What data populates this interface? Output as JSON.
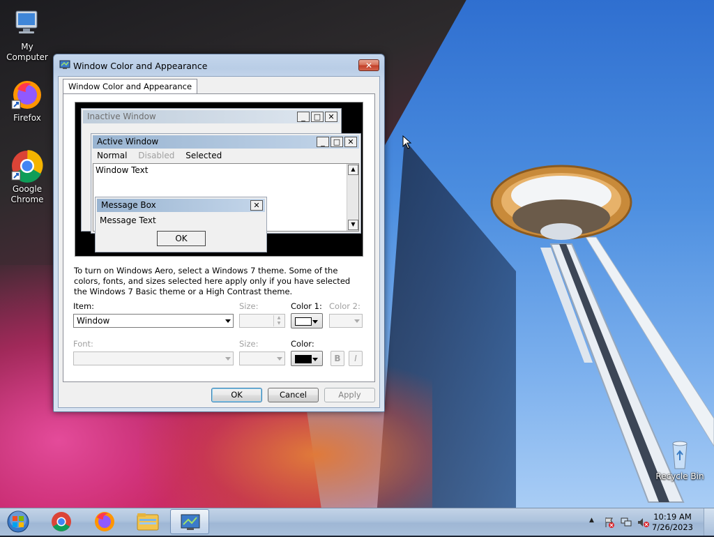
{
  "desktop": {
    "icons": [
      {
        "label": "My Computer"
      },
      {
        "label": "Firefox"
      },
      {
        "label": "Google Chrome"
      },
      {
        "label": "Recycle Bin"
      }
    ]
  },
  "dialog": {
    "title": "Window Color and Appearance",
    "close_label": "✕",
    "tab_label": "Window Color and Appearance",
    "preview": {
      "inactive_title": "Inactive Window",
      "active_title": "Active Window",
      "menu": [
        "Normal",
        "Disabled",
        "Selected"
      ],
      "window_text": "Window Text",
      "message_title": "Message Box",
      "message_text": "Message Text",
      "message_ok": "OK"
    },
    "description": "To turn on Windows Aero, select a Windows 7 theme.  Some of the colors, fonts, and sizes selected here apply only if you have selected the Windows 7 Basic theme or a High Contrast theme.",
    "item_label": "Item:",
    "item_value": "Window",
    "size_label": "Size:",
    "color1_label": "Color 1:",
    "color2_label": "Color 2:",
    "font_label": "Font:",
    "font_size_label": "Size:",
    "font_color_label": "Color:",
    "bold_label": "B",
    "italic_label": "I",
    "color1_swatch": "#ffffff",
    "font_color_swatch": "#000000",
    "buttons": {
      "ok": "OK",
      "cancel": "Cancel",
      "apply": "Apply"
    }
  },
  "taskbar": {
    "time": "10:19 AM",
    "date": "7/26/2023"
  }
}
